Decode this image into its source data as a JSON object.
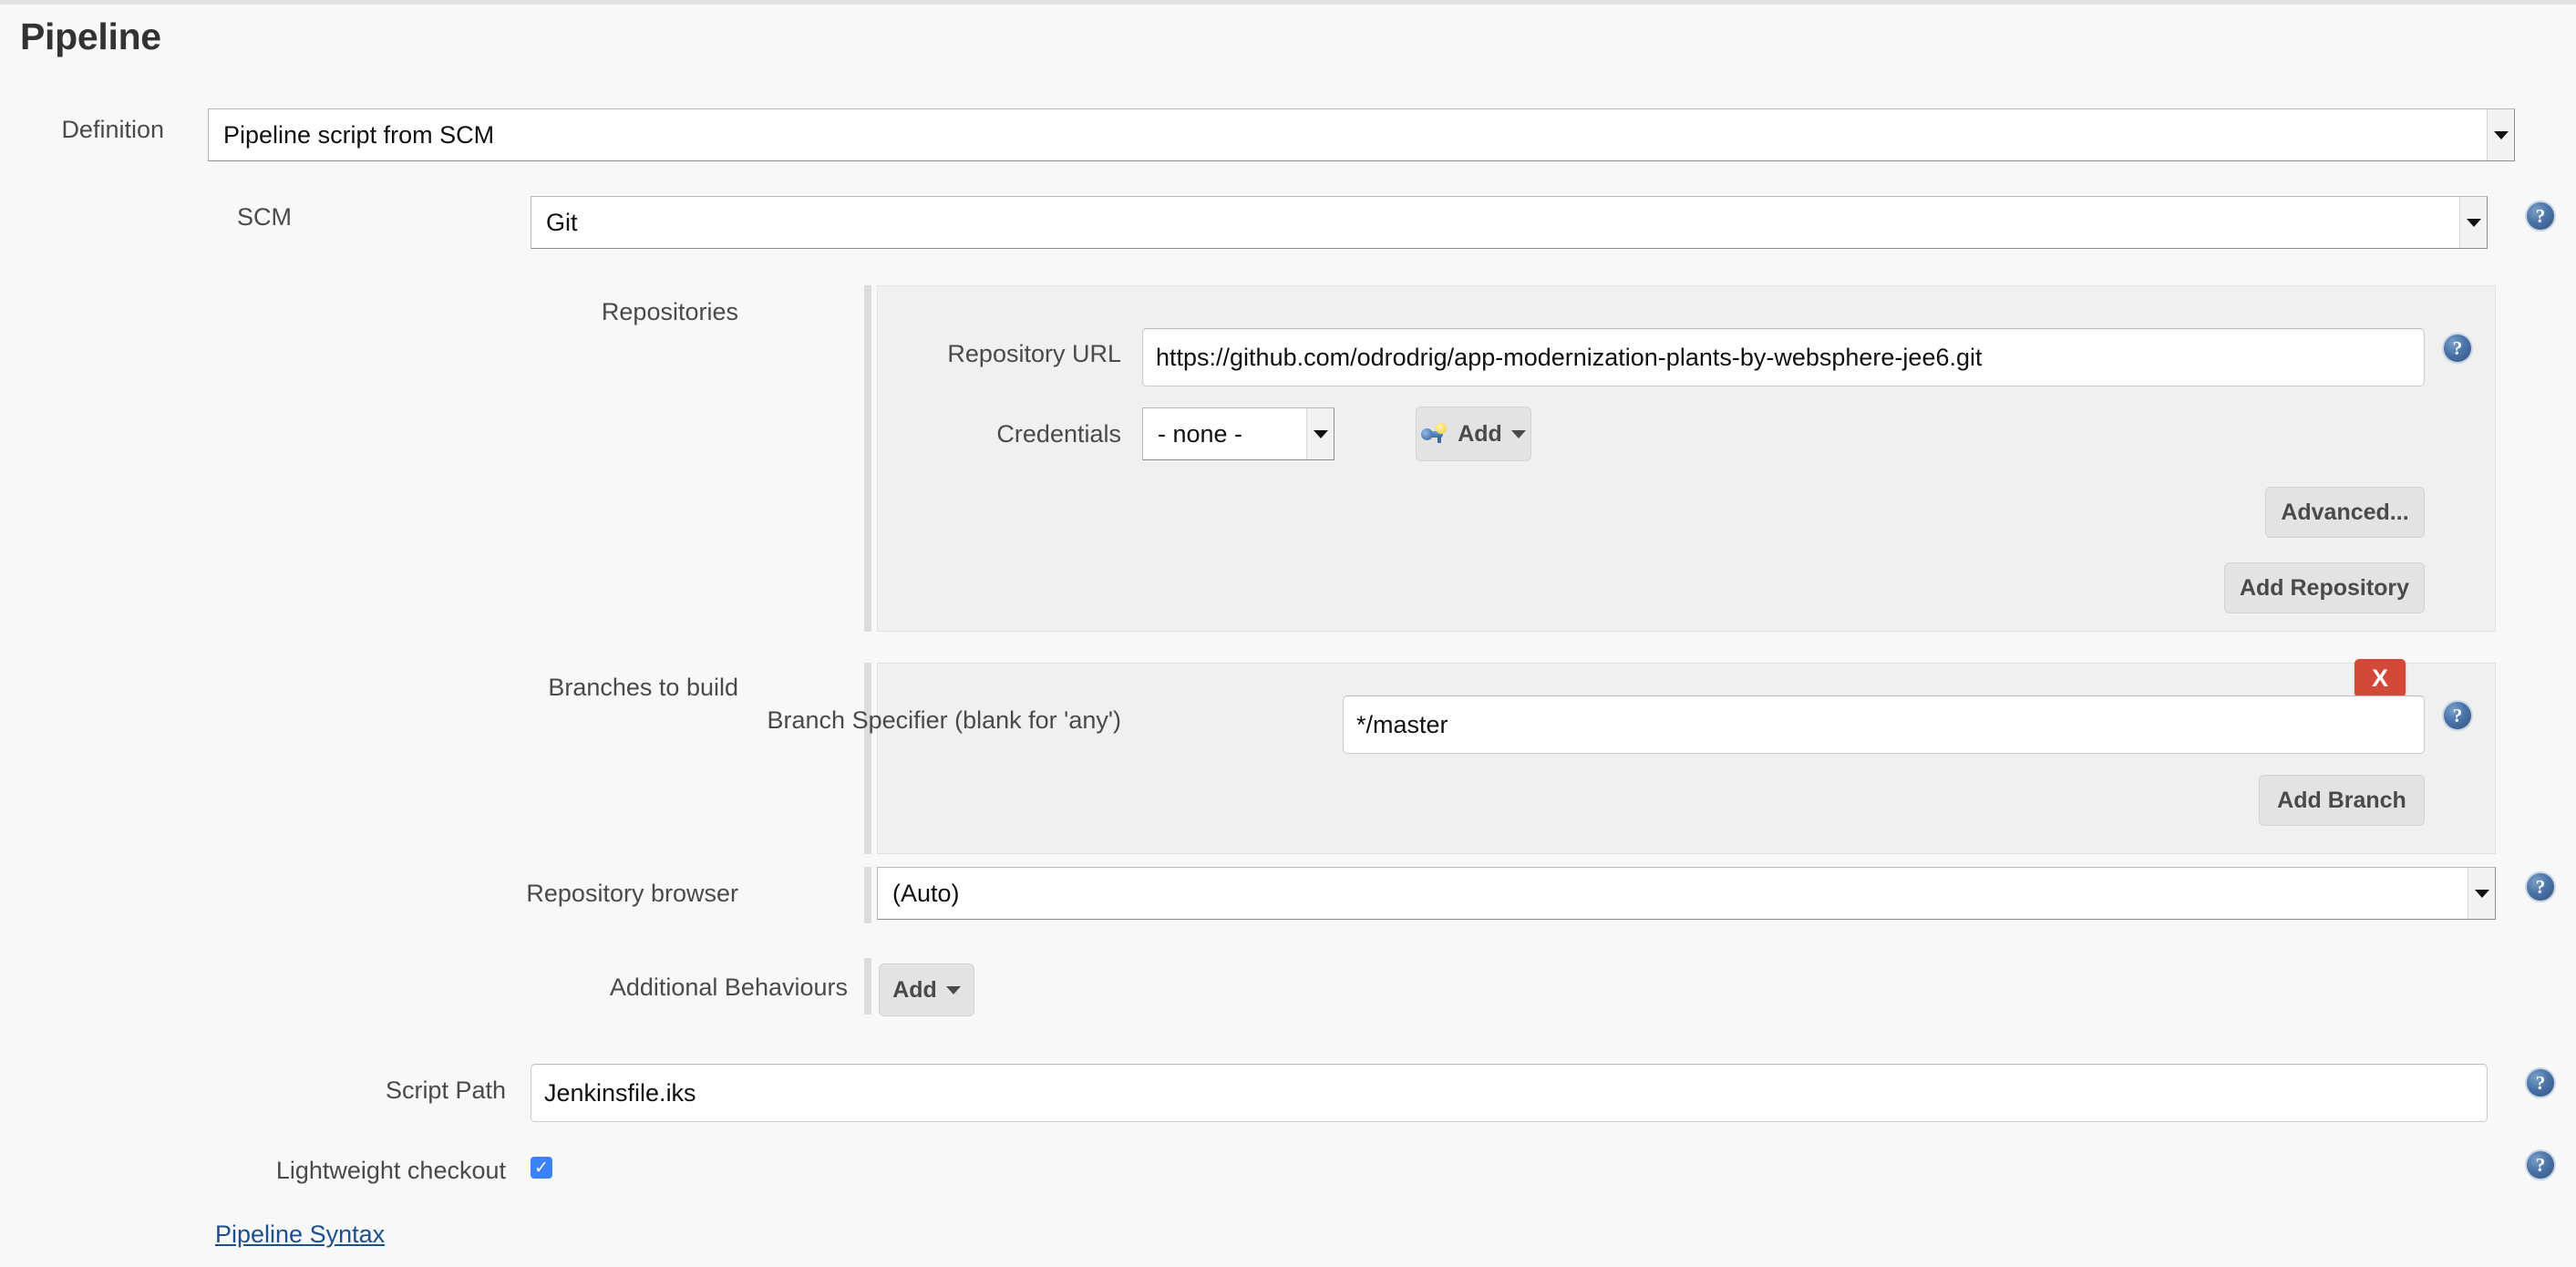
{
  "page": {
    "title": "Pipeline"
  },
  "definition": {
    "label": "Definition",
    "value": "Pipeline script from SCM"
  },
  "scm": {
    "label": "SCM",
    "value": "Git"
  },
  "repositories": {
    "label": "Repositories",
    "repository_url": {
      "label": "Repository URL",
      "value": "https://github.com/odrodrig/app-modernization-plants-by-websphere-jee6.git"
    },
    "credentials": {
      "label": "Credentials",
      "value": "- none -",
      "add_label": "Add"
    },
    "advanced_label": "Advanced...",
    "add_repository_label": "Add Repository"
  },
  "branches": {
    "label": "Branches to build",
    "delete_label": "X",
    "branch_specifier": {
      "label": "Branch Specifier (blank for 'any')",
      "value": "*/master"
    },
    "add_branch_label": "Add Branch"
  },
  "repository_browser": {
    "label": "Repository browser",
    "value": "(Auto)"
  },
  "additional_behaviours": {
    "label": "Additional Behaviours",
    "add_label": "Add"
  },
  "script_path": {
    "label": "Script Path",
    "value": "Jenkinsfile.iks"
  },
  "lightweight_checkout": {
    "label": "Lightweight checkout",
    "checked_mark": "✓"
  },
  "pipeline_syntax": {
    "label": "Pipeline Syntax"
  },
  "help": {
    "glyph": "?"
  },
  "colors": {
    "accent_red": "#d24939",
    "link_blue": "#1c4f8f",
    "checkbox_blue": "#3b82f6",
    "panel_bg": "#f0f0f0",
    "page_bg": "#f8f8f8"
  }
}
